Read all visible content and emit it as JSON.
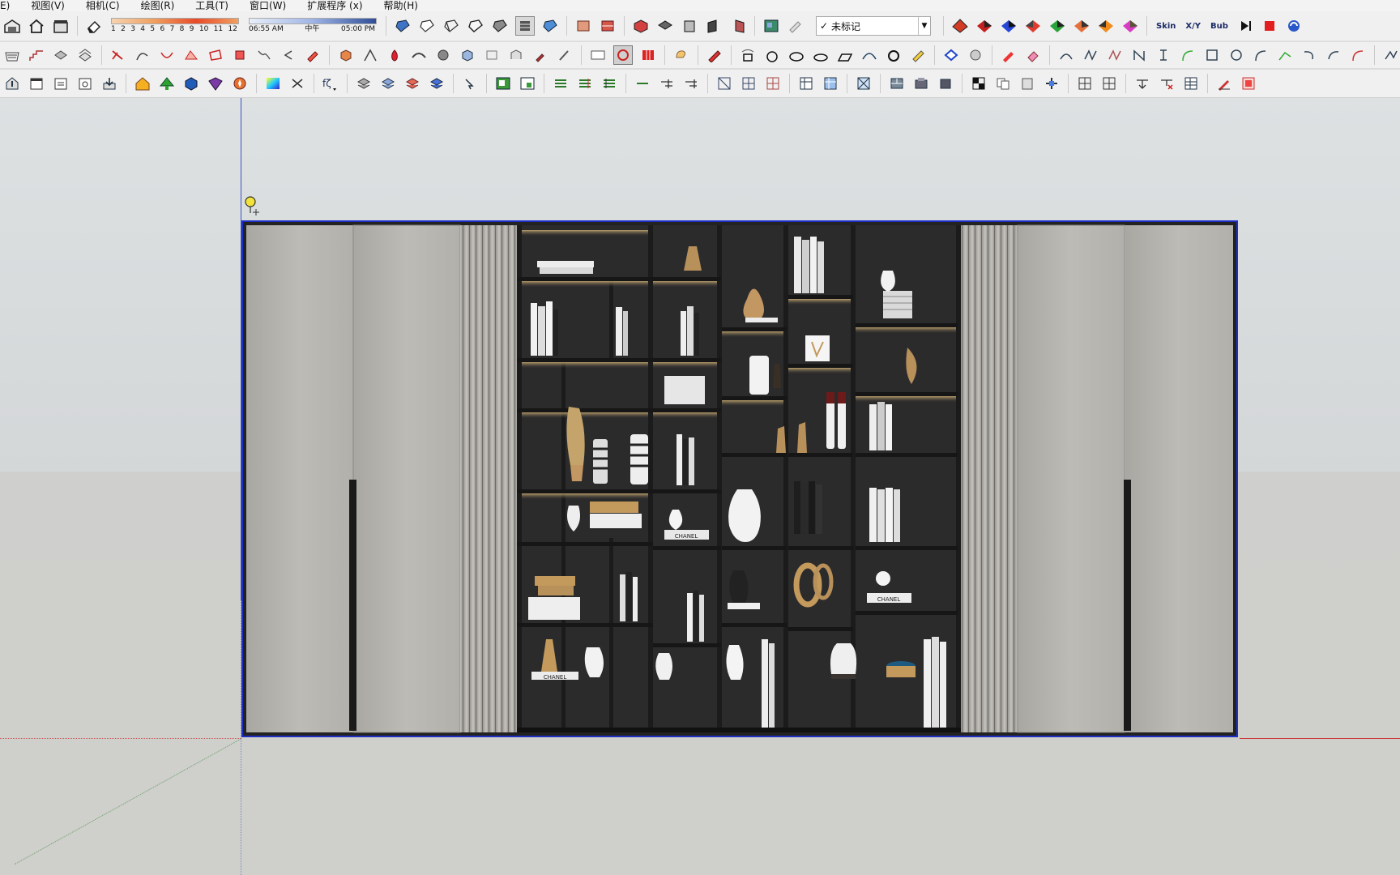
{
  "menubar": {
    "items": [
      "E)",
      "视图(V)",
      "相机(C)",
      "绘图(R)",
      "工具(T)",
      "窗口(W)",
      "扩展程序 (x)",
      "帮助(H)"
    ]
  },
  "shadow": {
    "months": [
      "1",
      "2",
      "3",
      "4",
      "5",
      "6",
      "7",
      "8",
      "9",
      "10",
      "11",
      "12"
    ],
    "time_start": "06:55 AM",
    "time_mid": "中午",
    "time_end": "05:00 PM"
  },
  "tag": {
    "check": "✓",
    "value": "未标记"
  },
  "text_buttons": {
    "skin": "Skin",
    "xy": "X/Y",
    "bub": "Bub"
  },
  "cabinet_labels": {
    "chanel_a": "CHANEL",
    "chanel_b": "CHANEL",
    "chanel_c": "CHANEL"
  },
  "colors": {
    "selection": "#1f2fc4",
    "axis_blue": "#3c52c6",
    "axis_red": "#cc3a3a",
    "door": "#b9b7b2",
    "shelf": "#2a2a2c",
    "brass": "#b8905a"
  }
}
